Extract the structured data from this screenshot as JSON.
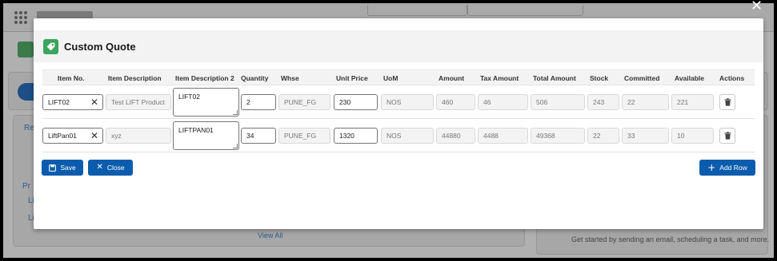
{
  "modal": {
    "title": "Custom Quote",
    "icon": "tag-icon",
    "accent_color": "#3ba55d"
  },
  "table": {
    "headers": {
      "item_no": "Item No.",
      "item_description": "Item Description",
      "item_description_2": "Item Description 2",
      "quantity": "Quantity",
      "whse": "Whse",
      "unit_price": "Unit Price",
      "uom": "UoM",
      "amount": "Amount",
      "tax_amount": "Tax Amount",
      "total_amount": "Total Amount",
      "stock": "Stock",
      "committed": "Committed",
      "available": "Available",
      "actions": "Actions"
    },
    "rows": [
      {
        "item_no": "LIFT02",
        "item_description": "Test LIFT Product",
        "item_description_2": "LIFT02",
        "quantity": "2",
        "whse": "PUNE_FG",
        "unit_price": "230",
        "uom": "NOS",
        "amount": "460",
        "tax_amount": "46",
        "total_amount": "506",
        "stock": "243",
        "committed": "22",
        "available": "221"
      },
      {
        "item_no": "LiftPan01",
        "item_description": "xyz",
        "item_description_2": "LIFTPAN01",
        "quantity": "34",
        "whse": "PUNE_FG",
        "unit_price": "1320",
        "uom": "NOS",
        "amount": "44880",
        "tax_amount": "4488",
        "total_amount": "49368",
        "stock": "22",
        "committed": "33",
        "available": "10"
      }
    ]
  },
  "footer": {
    "save_label": "Save",
    "close_label": "Close",
    "add_row_label": "Add Row",
    "button_color": "#0b5cad"
  },
  "background": {
    "view_all": "View All",
    "activity_hint": "Get started by sending an email, scheduling a task, and more."
  }
}
